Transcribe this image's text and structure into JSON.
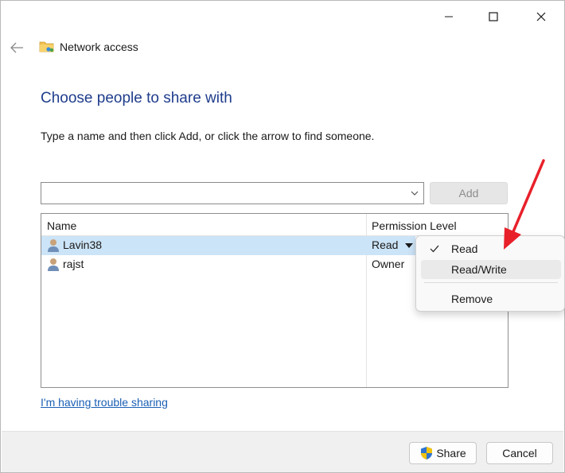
{
  "window": {
    "title": "Network access",
    "controls": {
      "minimize": "minimize-icon",
      "maximize": "maximize-icon",
      "close": "close-icon"
    }
  },
  "heading": "Choose people to share with",
  "instructions": "Type a name and then click Add, or click the arrow to find someone.",
  "name_input": {
    "value": "",
    "placeholder": ""
  },
  "add_button": "Add",
  "list": {
    "headers": {
      "name": "Name",
      "permission": "Permission Level"
    },
    "rows": [
      {
        "name": "Lavin38",
        "permission": "Read",
        "selected": true
      },
      {
        "name": "rajst",
        "permission": "Owner",
        "selected": false
      }
    ]
  },
  "permission_menu": {
    "items": [
      {
        "label": "Read",
        "checked": true
      },
      {
        "label": "Read/Write",
        "checked": false,
        "highlighted": true
      },
      {
        "label": "Remove",
        "checked": false
      }
    ]
  },
  "help_link": "I'm having trouble sharing",
  "footer": {
    "share": "Share",
    "cancel": "Cancel"
  },
  "colors": {
    "heading": "#1f3d8c",
    "link": "#1a5fb4",
    "selection": "#cce4f7",
    "annotation": "#e8202a"
  }
}
